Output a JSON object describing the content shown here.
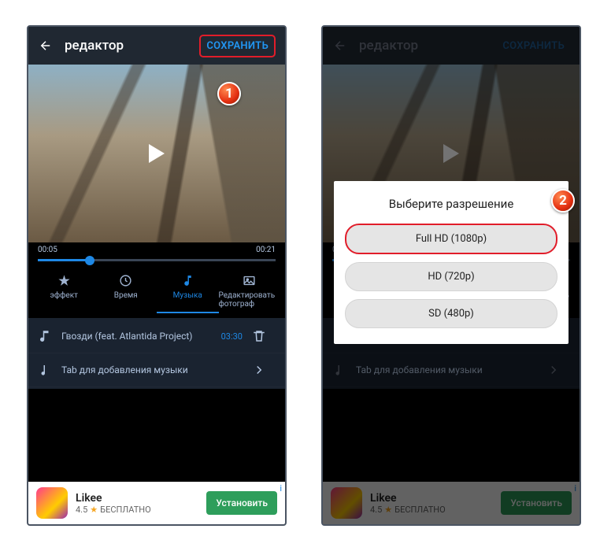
{
  "header": {
    "title": "редактор",
    "save": "СОХРАНИТЬ"
  },
  "timeline": {
    "current": "00:05",
    "total": "00:21"
  },
  "tabs": [
    {
      "label": "эффект"
    },
    {
      "label": "Время"
    },
    {
      "label": "Музыка"
    },
    {
      "label": "Редактировать фотограф"
    }
  ],
  "music": {
    "track": "Гвозди (feat. Atlantida Project)",
    "duration": "03:30",
    "add": "Tab для добавления музыки"
  },
  "ad": {
    "name": "Likee",
    "rating": "4.5",
    "free": "БЕСПЛАТНО",
    "cta": "Установить",
    "info": "i"
  },
  "modal": {
    "title": "Выберите разрешение",
    "opts": [
      "Full HD (1080p)",
      "HD (720p)",
      "SD (480p)"
    ]
  },
  "badges": {
    "one": "1",
    "two": "2"
  }
}
